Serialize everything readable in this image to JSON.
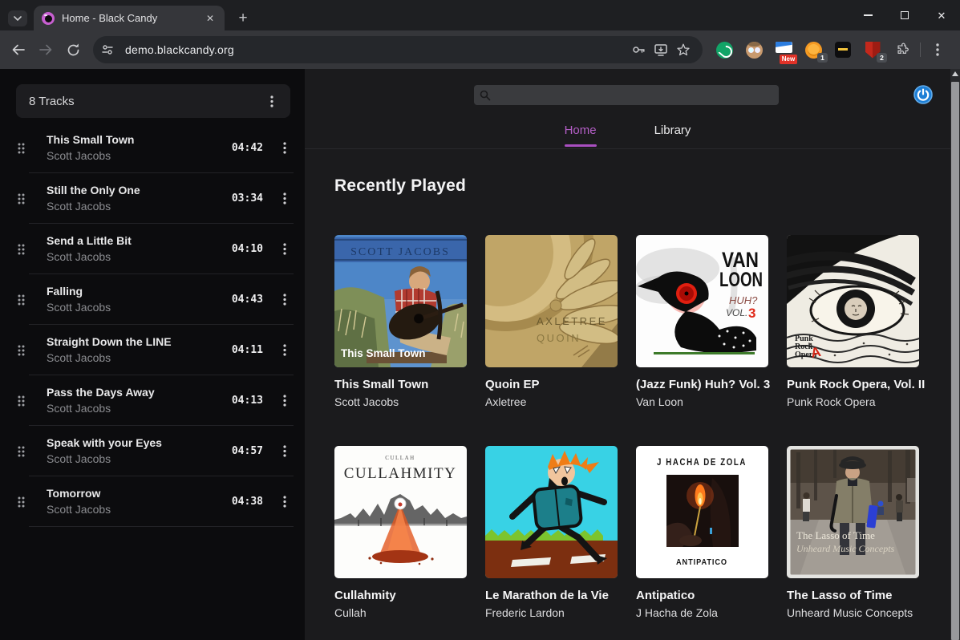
{
  "browser": {
    "tab_title": "Home - Black Candy",
    "url": "demo.blackcandy.org",
    "new_tab_label": "+",
    "close_tab_label": "✕",
    "minimize_label": "",
    "close_window_label": "✕",
    "extensions": {
      "new_badge": "New",
      "orange_badge": "1",
      "shield_badge": "2"
    }
  },
  "sidebar": {
    "header_label": "8 Tracks",
    "tracks": [
      {
        "title": "This Small Town",
        "artist": "Scott Jacobs",
        "duration": "04:42"
      },
      {
        "title": "Still the Only One",
        "artist": "Scott Jacobs",
        "duration": "03:34"
      },
      {
        "title": "Send a Little Bit",
        "artist": "Scott Jacobs",
        "duration": "04:10"
      },
      {
        "title": "Falling",
        "artist": "Scott Jacobs",
        "duration": "04:43"
      },
      {
        "title": "Straight Down the LINE",
        "artist": "Scott Jacobs",
        "duration": "04:11"
      },
      {
        "title": "Pass the Days Away",
        "artist": "Scott Jacobs",
        "duration": "04:13"
      },
      {
        "title": "Speak with your Eyes",
        "artist": "Scott Jacobs",
        "duration": "04:57"
      },
      {
        "title": "Tomorrow",
        "artist": "Scott Jacobs",
        "duration": "04:38"
      }
    ]
  },
  "main": {
    "search_placeholder": "",
    "tabs": [
      {
        "label": "Home"
      },
      {
        "label": "Library"
      }
    ],
    "section_title": "Recently Played",
    "albums": [
      {
        "title": "This Small Town",
        "artist": "Scott Jacobs",
        "cover": {
          "top": "SCOTT JACOBS",
          "bottom": "This Small Town"
        }
      },
      {
        "title": "Quoin EP",
        "artist": "Axletree",
        "cover": {
          "line1": "AXLETREE",
          "line2": "QUOIN"
        }
      },
      {
        "title": "(Jazz Funk) Huh? Vol. 3",
        "artist": "Van Loon",
        "cover": {
          "line1": "VAN",
          "line2": "LOON",
          "line3": "HUH?",
          "line4": "VOL.",
          "line5": "3"
        }
      },
      {
        "title": "Punk Rock Opera, Vol. II",
        "artist": "Punk Rock Opera",
        "cover": {
          "line1": "Punk",
          "line2": "Rock",
          "line3": "Opera",
          "mark": "A"
        }
      },
      {
        "title": "Cullahmity",
        "artist": "Cullah",
        "cover": {
          "line1": "CULLAH",
          "line2": "CULLAHMITY"
        }
      },
      {
        "title": "Le Marathon de la Vie",
        "artist": "Frederic Lardon",
        "cover": {}
      },
      {
        "title": "Antipatico",
        "artist": "J Hacha de Zola",
        "cover": {
          "line1": "J HACHA DE ZOLA",
          "line2": "ANTIPATICO"
        }
      },
      {
        "title": "The Lasso of Time",
        "artist": "Unheard Music Concepts",
        "cover": {
          "line1": "The Lasso of Time",
          "line2": "Unheard Music Concepts"
        }
      }
    ]
  },
  "colors": {
    "accent": "#b45fc6",
    "power_blue": "#1d7fd6"
  }
}
